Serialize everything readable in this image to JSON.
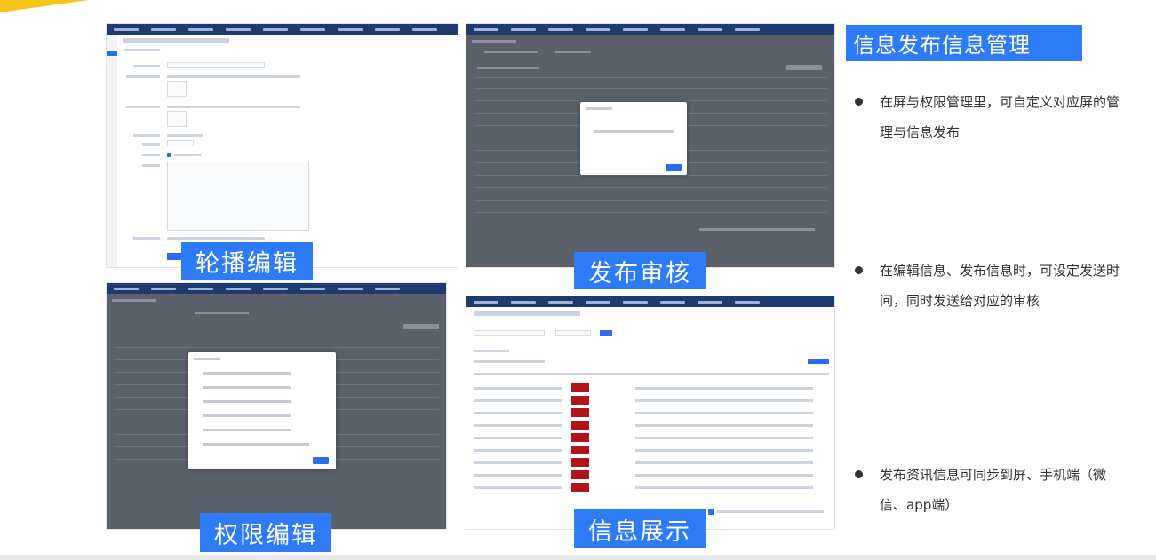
{
  "panels": {
    "carousel_edit": "轮播编辑",
    "publish_review": "发布审核",
    "permission_edit": "权限编辑",
    "info_display": "信息展示"
  },
  "sidebar": {
    "title": "信息发布信息管理",
    "bullets": [
      {
        "text": "在屏与权限管理里，可自定义对应屏的管理与信息发布"
      },
      {
        "text": "在编辑信息、发布信息时，可设定发送时间，同时发送给对应的审核"
      },
      {
        "text": "发布资讯信息可同步到屏、手机端（微信、app端）"
      }
    ]
  },
  "colors": {
    "accent": "#2d7bf6",
    "corner": "#f5c518",
    "nav": "#1f3a6e"
  }
}
